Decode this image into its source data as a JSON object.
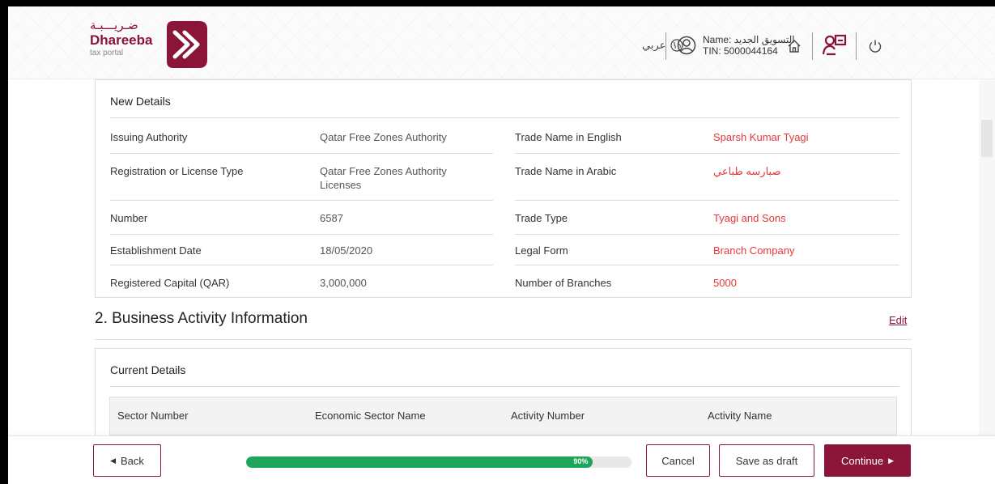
{
  "header": {
    "logo_ar": "ضـريـــبـة",
    "logo_en": "Dhareeba",
    "logo_sub": "tax portal",
    "language_label": "عربي",
    "user_name_line": "Name: التسويق الجديد",
    "user_tin_line": "TIN: 5000044164"
  },
  "new_details": {
    "title": "New Details",
    "rows": [
      {
        "l1": "Issuing Authority",
        "v1": "Qatar Free Zones Authority",
        "l2": "Trade Name in English",
        "v2": "Sparsh Kumar Tyagi"
      },
      {
        "l1": "Registration or License Type",
        "v1": "Qatar Free Zones Authority Licenses",
        "l2": "Trade Name in Arabic",
        "v2": "صبارسه طباعي"
      },
      {
        "l1": "Number",
        "v1": "6587",
        "l2": "Trade Type",
        "v2": "Tyagi and Sons"
      },
      {
        "l1": "Establishment Date",
        "v1": "18/05/2020",
        "l2": "Legal Form",
        "v2": "Branch Company"
      },
      {
        "l1": "Registered Capital (QAR)",
        "v1": "3,000,000",
        "l2": "Number of Branches",
        "v2": "5000"
      }
    ]
  },
  "business_activity": {
    "title": "2. Business Activity Information",
    "edit_label": "Edit",
    "current_details_title": "Current Details",
    "columns": [
      "Sector Number",
      "Economic Sector Name",
      "Activity Number",
      "Activity Name"
    ]
  },
  "footer": {
    "back_label": "Back",
    "progress_percent": 90,
    "progress_label": "90%",
    "cancel_label": "Cancel",
    "save_draft_label": "Save as draft",
    "continue_label": "Continue"
  },
  "colors": {
    "brand": "#8a1538",
    "changed_value": "#e5383b",
    "progress": "#1ea55a"
  }
}
